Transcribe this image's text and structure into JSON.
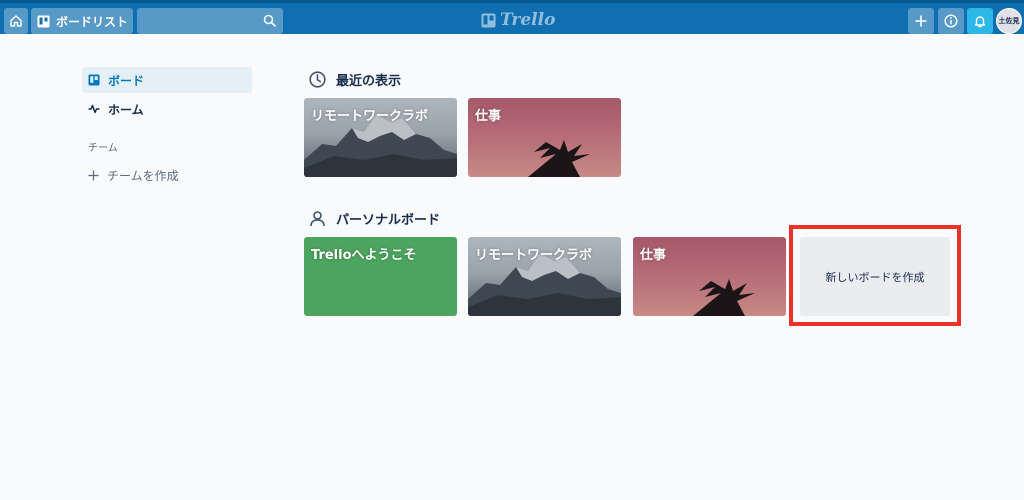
{
  "header": {
    "boards_label": "ボードリスト",
    "logo_text": "Trello",
    "avatar_text": "土佐見",
    "bg_color": "#0f6fb1",
    "notification_color": "#2db6e8",
    "icons": [
      "home-icon",
      "board-icon",
      "search-icon",
      "trello-logo-icon",
      "plus-icon",
      "info-icon",
      "bell-icon"
    ]
  },
  "sidebar": {
    "items": [
      {
        "label": "ボード",
        "icon": "board-icon",
        "active": true
      },
      {
        "label": "ホーム",
        "icon": "activity-icon",
        "active": false
      }
    ],
    "team_title": "チーム",
    "create_team_label": "チームを作成"
  },
  "recent": {
    "title": "最近の表示",
    "icon": "clock-icon",
    "boards": [
      {
        "name": "リモートワークラボ",
        "background": "mountain"
      },
      {
        "name": "仕事",
        "background": "sunset"
      }
    ]
  },
  "personal": {
    "title": "パーソナルボード",
    "icon": "person-icon",
    "boards": [
      {
        "name": "Trelloへようこそ",
        "background": "green"
      },
      {
        "name": "リモートワークラボ",
        "background": "mountain"
      },
      {
        "name": "仕事",
        "background": "sunset"
      }
    ],
    "create_label": "新しいボードを作成"
  },
  "highlight_color": "#e8322a"
}
